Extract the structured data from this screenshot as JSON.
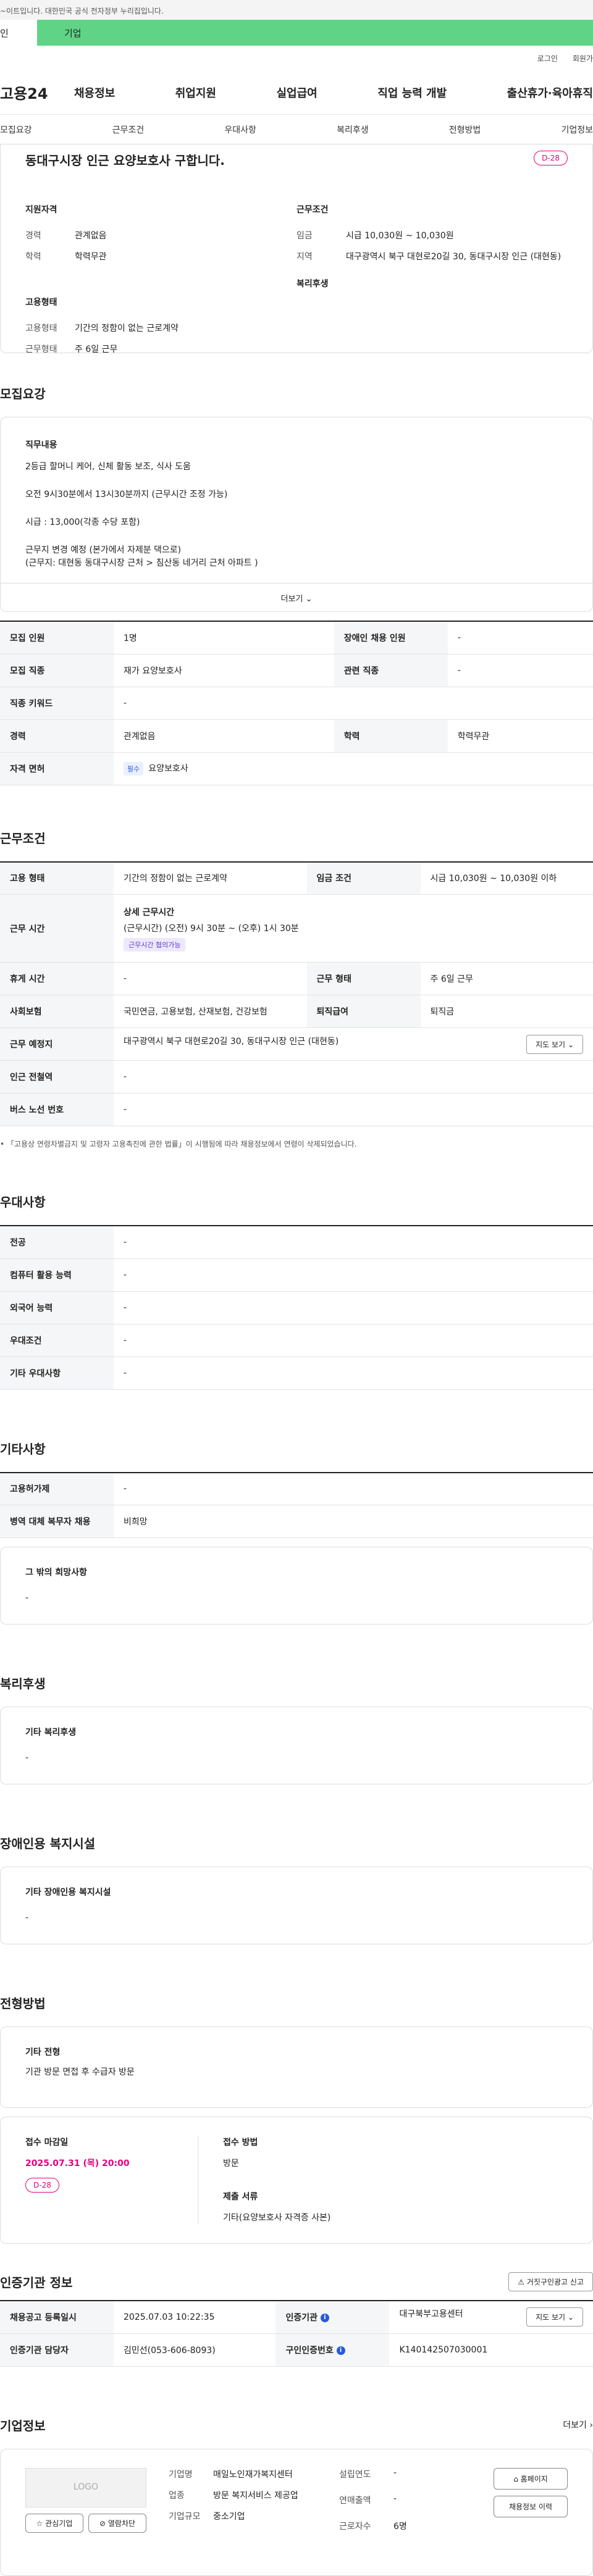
{
  "gov_bar_text": "~이트입니다. 대한민국 공식 전자정부 누리집입니다.",
  "top_tabs": {
    "personal": "인",
    "company": "기업"
  },
  "util": {
    "login": "로그인",
    "join": "회원가"
  },
  "logo": "고용24",
  "gnb": [
    "채용정보",
    "취업지원",
    "실업급여",
    "직업 능력 개발",
    "출산휴가·육아휴직"
  ],
  "anchor_nav": [
    "모집요강",
    "근무조건",
    "우대사항",
    "복리후생",
    "전형방법",
    "기업정보"
  ],
  "summary": {
    "title": "동대구시장 인근 요양보호사 구합니다.",
    "dday": "D-28",
    "qualification_h": "지원자격",
    "qual": [
      {
        "k": "경력",
        "v": "관계없음"
      },
      {
        "k": "학력",
        "v": "학력무관"
      }
    ],
    "employment_h": "고용형태",
    "emp": [
      {
        "k": "고용형태",
        "v": "기간의 정함이 없는 근로계약"
      },
      {
        "k": "근무형태",
        "v": "주 6일 근무"
      }
    ],
    "condition_h": "근무조건",
    "cond": [
      {
        "k": "임금",
        "v": "시급 10,030원 ~ 10,030원"
      },
      {
        "k": "지역",
        "v": "대구광역시 북구 대현로20길 30, 동대구시장 인근 (대현동)"
      }
    ],
    "welfare_h": "복리후생"
  },
  "recruit": {
    "title": "모집요강",
    "label": "직무내용",
    "lines": [
      "2등급 할머니 케어, 신체 활동 보조, 식사 도움",
      "오전 9시30분에서 13시30분까지 (근무시간 조정 가능)",
      "시급 : 13,000(각종 수당 포함)",
      "근무지 변경 예정 (본가에서 자제분 댁으로)\n(근무지: 대현동 동대구시장 근처 > 침산동 네거리 근처 아파트 )"
    ],
    "more": "더보기",
    "rows": [
      {
        "k1": "모집 인원",
        "v1": "1명",
        "k2": "장애인 채용 인원",
        "v2": "-"
      },
      {
        "k1": "모집 직종",
        "v1": "재가 요양보호사",
        "k2": "관련 직종",
        "v2": "-"
      },
      {
        "k1": "직종 키워드",
        "v1": "-"
      },
      {
        "k1": "경력",
        "v1": "관계없음",
        "k2": "학력",
        "v2": "학력무관"
      }
    ],
    "license_k": "자격 면허",
    "license_tag": "필수",
    "license_v": "요양보호사"
  },
  "cond": {
    "title": "근무조건",
    "emp_type_k": "고용 형태",
    "emp_type_v": "기간의 정함이 없는 근로계약",
    "wage_k": "임금 조건",
    "wage_v": "시급 10,030원 ~ 10,030원 이하",
    "time_k": "근무 시간",
    "time_h": "상세 근무시간",
    "time_v": "(근무시간) (오전) 9시 30분 ~ (오후) 1시 30분",
    "time_tag": "근무시간 협의가능",
    "rest_k": "휴게 시간",
    "rest_v": "-",
    "form_k": "근무 형태",
    "form_v": "주 6일 근무",
    "ins_k": "사회보험",
    "ins_v": "국민연금, 고용보험, 산재보험, 건강보험",
    "ret_k": "퇴직급여",
    "ret_v": "퇴직금",
    "place_k": "근무 예정지",
    "place_v": "대구광역시 북구 대현로20길 30, 동대구시장 인근 (대현동)",
    "map_btn": "지도 보기",
    "subway_k": "인근 전철역",
    "subway_v": "-",
    "bus_k": "버스 노선 번호",
    "bus_v": "-",
    "note": "「고용상 연령차별금지 및 고령자 고용촉진에 관한 법률」이 시행됨에 따라 채용정보에서 연령이 삭제되었습니다."
  },
  "pref": {
    "title": "우대사항",
    "rows": [
      {
        "k": "전공",
        "v": "-"
      },
      {
        "k": "컴퓨터 활용 능력",
        "v": "-"
      },
      {
        "k": "외국어 능력",
        "v": "-"
      },
      {
        "k": "우대조건",
        "v": "-"
      },
      {
        "k": "기타 우대사항",
        "v": "-"
      }
    ]
  },
  "etc": {
    "title": "기타사항",
    "rows": [
      {
        "k": "고용허가제",
        "v": "-"
      },
      {
        "k": "병역 대체 복무자 채용",
        "v": "비희망"
      }
    ],
    "box_label": "그 밖의 희망사항",
    "box_v": "-"
  },
  "welfare": {
    "title": "복리후생",
    "label": "기타 복리후생",
    "v": "-"
  },
  "disab": {
    "title": "장애인용 복지시설",
    "label": "기타 장애인용 복지시설",
    "v": "-"
  },
  "select": {
    "title": "전형방법",
    "label": "기타 전형",
    "v": "기관 방문 면접 후 수급자 방문",
    "deadline_h": "접수 마감일",
    "deadline": "2025.07.31 (목) 20:00",
    "dday": "D-28",
    "method_h": "접수 방법",
    "method": "방문",
    "docs_h": "제출 서류",
    "docs": "기타(요양보호사 자격증 사본)"
  },
  "cert": {
    "title": "인증기관 정보",
    "report_btn": "거짓구인광고 신고",
    "reg_k": "채용공고 등록일시",
    "reg_v": "2025.07.03 10:22:35",
    "org_k": "인증기관",
    "org_v": "대구북부고용센터",
    "map_btn": "지도 보기",
    "mgr_k": "인증기관 담당자",
    "mgr_v": "김민선(053-606-8093)",
    "id_k": "구인인증번호",
    "id_v": "K140142507030001"
  },
  "company": {
    "title": "기업정보",
    "more": "더보기",
    "logo": "LOGO",
    "fav_btn": "관심기업",
    "block_btn": "열람차단",
    "rows": [
      {
        "k": "기업명",
        "v": "매일노인재가복지센터"
      },
      {
        "k": "업종",
        "v": "방문 복지서비스 제공업"
      },
      {
        "k": "기업규모",
        "v": "중소기업"
      }
    ],
    "rows2": [
      {
        "k": "설립연도",
        "v": "-"
      },
      {
        "k": "연매출액",
        "v": "-"
      },
      {
        "k": "근로자수",
        "v": "6명"
      }
    ],
    "home_btn": "홈페이지",
    "jobs_btn": "채용정보 이력"
  }
}
